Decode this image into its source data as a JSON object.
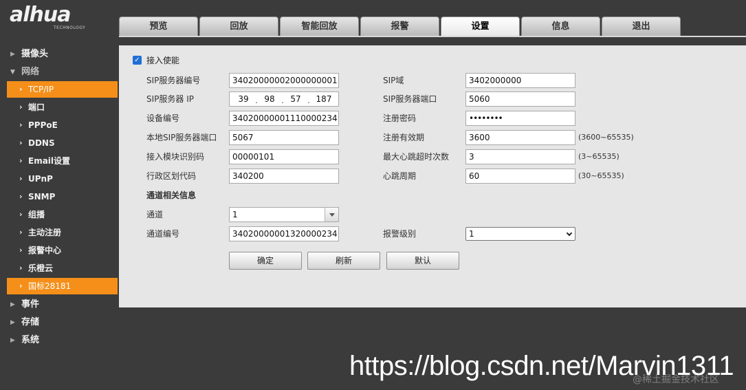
{
  "brand": {
    "logo_text": "alhua",
    "logo_sub": "TECHNOLOGY"
  },
  "nav": {
    "tabs": [
      {
        "label": "预览"
      },
      {
        "label": "回放"
      },
      {
        "label": "智能回放"
      },
      {
        "label": "报警"
      },
      {
        "label": "设置",
        "active": true
      },
      {
        "label": "信息"
      },
      {
        "label": "退出"
      }
    ]
  },
  "sidebar": {
    "items": [
      {
        "label": "摄像头"
      },
      {
        "label": "网络"
      },
      {
        "label": "TCP/IP"
      },
      {
        "label": "端口"
      },
      {
        "label": "PPPoE"
      },
      {
        "label": "DDNS"
      },
      {
        "label": "Email设置"
      },
      {
        "label": "UPnP"
      },
      {
        "label": "SNMP"
      },
      {
        "label": "组播"
      },
      {
        "label": "主动注册"
      },
      {
        "label": "报警中心"
      },
      {
        "label": "乐橙云"
      },
      {
        "label": "国标28181",
        "selected": true
      },
      {
        "label": "事件"
      },
      {
        "label": "存储"
      },
      {
        "label": "系统"
      }
    ]
  },
  "form": {
    "enable_label": "接入使能",
    "enabled": true,
    "sip_server_id_label": "SIP服务器编号",
    "sip_server_id": "34020000002000000001",
    "sip_domain_label": "SIP域",
    "sip_domain": "3402000000",
    "sip_server_ip_label": "SIP服务器 IP",
    "sip_server_ip": [
      "39",
      "98",
      "57",
      "187"
    ],
    "sip_server_port_label": "SIP服务器端口",
    "sip_server_port": "5060",
    "device_id_label": "设备编号",
    "device_id": "34020000001110000234",
    "register_password_label": "注册密码",
    "register_password": "••••••••",
    "local_sip_port_label": "本地SIP服务器端口",
    "local_sip_port": "5067",
    "register_validity_label": "注册有效期",
    "register_validity": "3600",
    "register_validity_range": "(3600~65535)",
    "module_id_label": "接入模块识别码",
    "module_id": "00000101",
    "max_heartbeat_timeout_label": "最大心跳超时次数",
    "max_heartbeat_timeout": "3",
    "max_heartbeat_timeout_range": "(3~65535)",
    "region_code_label": "行政区划代码",
    "region_code": "340200",
    "heartbeat_period_label": "心跳周期",
    "heartbeat_period": "60",
    "heartbeat_period_range": "(30~65535)",
    "channel_section_title": "通道相关信息",
    "channel_label": "通道",
    "channel": "1",
    "channel_id_label": "通道编号",
    "channel_id": "34020000001320000234",
    "alarm_level_label": "报警级别",
    "alarm_level": "1"
  },
  "buttons": {
    "ok": "确定",
    "refresh": "刷新",
    "default": "默认"
  },
  "watermark": {
    "url": "https://blog.csdn.net/Marvin1311",
    "community": "@稀土掘金技术社区"
  }
}
